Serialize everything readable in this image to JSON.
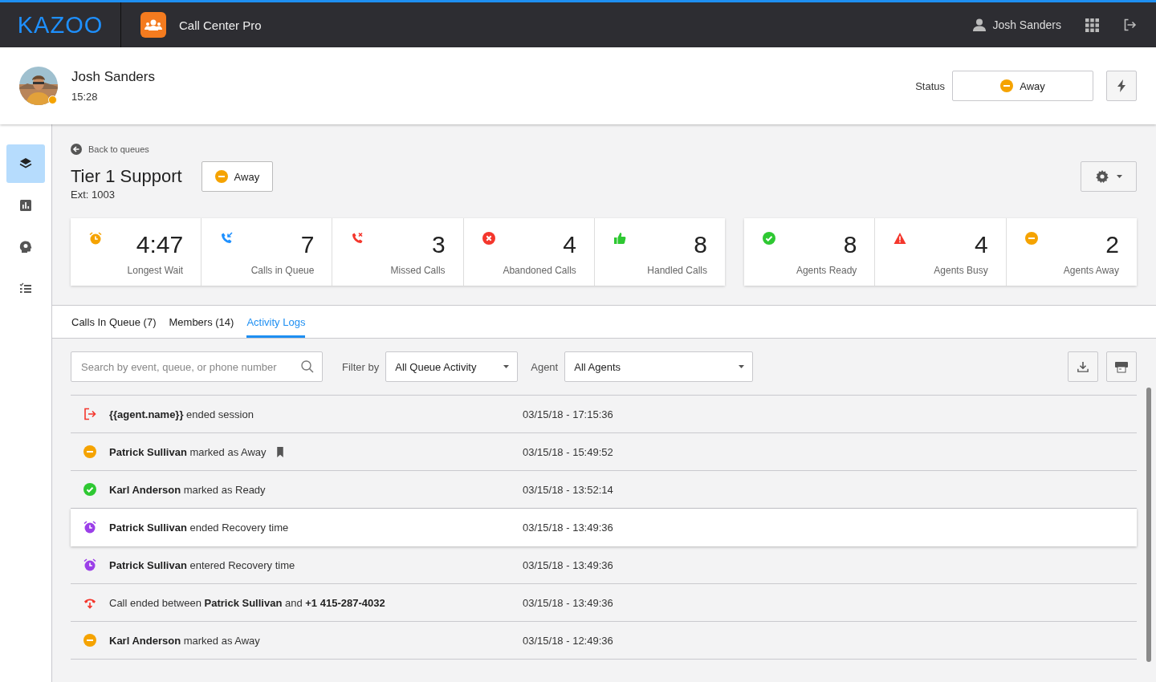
{
  "topbar": {
    "logo": "KAZOO",
    "app_name": "Call Center Pro",
    "user_name": "Josh Sanders"
  },
  "agent": {
    "name": "Josh Sanders",
    "time": "15:28",
    "status_label": "Status",
    "status": {
      "kind": "away",
      "label": "Away"
    }
  },
  "sidebar": {
    "items": [
      {
        "kind": "queues",
        "selected": true
      },
      {
        "kind": "stats",
        "selected": false
      },
      {
        "kind": "agents",
        "selected": false
      },
      {
        "kind": "logs",
        "selected": false
      }
    ]
  },
  "queue": {
    "back_link": "Back to queues",
    "title": "Tier 1 Support",
    "status": "Away",
    "ext": "Ext: 1003"
  },
  "stat_groups": [
    [
      {
        "kind": "wait",
        "value": "4:47",
        "label": "Longest Wait"
      },
      {
        "kind": "incoming",
        "value": "7",
        "label": "Calls in Queue"
      },
      {
        "kind": "missed",
        "value": "3",
        "label": "Missed Calls"
      },
      {
        "kind": "abandoned",
        "value": "4",
        "label": "Abandoned Calls"
      },
      {
        "kind": "handled",
        "value": "8",
        "label": "Handled Calls"
      }
    ],
    [
      {
        "kind": "ready",
        "value": "8",
        "label": "Agents Ready"
      },
      {
        "kind": "busy",
        "value": "4",
        "label": "Agents Busy"
      },
      {
        "kind": "away",
        "value": "2",
        "label": "Agents Away"
      }
    ]
  ],
  "tabs": [
    {
      "label": "Calls In Queue (7)",
      "selected": false
    },
    {
      "label": "Members (14)",
      "selected": false
    },
    {
      "label": "Activity Logs",
      "selected": true
    }
  ],
  "filters": {
    "search_placeholder": "Search by event, queue, or phone number",
    "filter_label": "Filter by",
    "filter_value": "All Queue Activity",
    "agent_label": "Agent",
    "agent_value": "All Agents"
  },
  "logs": [
    {
      "kind": "session-end",
      "text": "**{{agent.name}}** ended session",
      "time": "03/15/18 - 17:15:36",
      "bookmarked": false,
      "highlighted": false
    },
    {
      "kind": "away",
      "text": "**Patrick Sullivan** marked as Away",
      "time": "03/15/18 - 15:49:52",
      "bookmarked": true,
      "highlighted": false
    },
    {
      "kind": "ready",
      "text": "**Karl Anderson** marked as Ready",
      "time": "03/15/18 - 13:52:14",
      "bookmarked": false,
      "highlighted": false
    },
    {
      "kind": "recovery",
      "text": "**Patrick Sullivan** ended Recovery time",
      "time": "03/15/18 - 13:49:36",
      "bookmarked": false,
      "highlighted": true
    },
    {
      "kind": "recovery",
      "text": "**Patrick Sullivan** entered Recovery time",
      "time": "03/15/18 - 13:49:36",
      "bookmarked": false,
      "highlighted": false
    },
    {
      "kind": "call-end",
      "text": "Call ended between **Patrick Sullivan** and **+1 415-287-4032**",
      "time": "03/15/18 - 13:49:36",
      "bookmarked": false,
      "highlighted": false
    },
    {
      "kind": "away",
      "text": "**Karl Anderson** marked as Away",
      "time": "03/15/18 - 12:49:36",
      "bookmarked": false,
      "highlighted": false
    }
  ]
}
